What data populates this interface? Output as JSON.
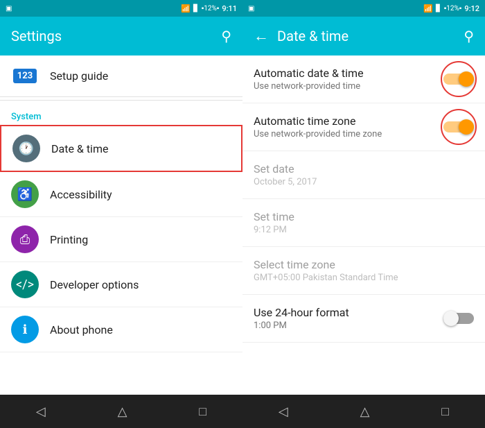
{
  "left_panel": {
    "status_bar": {
      "time": "9:11",
      "battery": "12%"
    },
    "top_bar": {
      "title": "Settings",
      "search_icon": "🔍"
    },
    "setup_guide": {
      "label": "Setup guide",
      "icon_text": "123"
    },
    "section_system": {
      "label": "System"
    },
    "items": [
      {
        "id": "date-time",
        "label": "Date & time",
        "icon": "clock",
        "highlighted": true
      },
      {
        "id": "accessibility",
        "label": "Accessibility",
        "icon": "accessibility"
      },
      {
        "id": "printing",
        "label": "Printing",
        "icon": "printing"
      },
      {
        "id": "developer",
        "label": "Developer options",
        "icon": "developer"
      },
      {
        "id": "about",
        "label": "About phone",
        "icon": "about"
      }
    ],
    "nav": {
      "back": "◁",
      "home": "△",
      "recent": "□"
    }
  },
  "right_panel": {
    "status_bar": {
      "time": "9:12",
      "battery": "12%"
    },
    "top_bar": {
      "title": "Date & time",
      "back_icon": "←",
      "search_icon": "🔍"
    },
    "items": [
      {
        "id": "auto-date",
        "label": "Automatic date & time",
        "sublabel": "Use network-provided time",
        "toggle": true,
        "toggle_on": true,
        "grayed": false
      },
      {
        "id": "auto-timezone",
        "label": "Automatic time zone",
        "sublabel": "Use network-provided time zone",
        "toggle": true,
        "toggle_on": true,
        "grayed": false
      },
      {
        "id": "set-date",
        "label": "Set date",
        "sublabel": "October 5, 2017",
        "toggle": false,
        "grayed": true
      },
      {
        "id": "set-time",
        "label": "Set time",
        "sublabel": "9:12 PM",
        "toggle": false,
        "grayed": true
      },
      {
        "id": "select-timezone",
        "label": "Select time zone",
        "sublabel": "GMT+05:00 Pakistan Standard Time",
        "toggle": false,
        "grayed": true
      },
      {
        "id": "24hour",
        "label": "Use 24-hour format",
        "sublabel": "1:00 PM",
        "toggle": true,
        "toggle_on": false,
        "grayed": false
      }
    ],
    "nav": {
      "back": "◁",
      "home": "△",
      "recent": "□"
    }
  }
}
